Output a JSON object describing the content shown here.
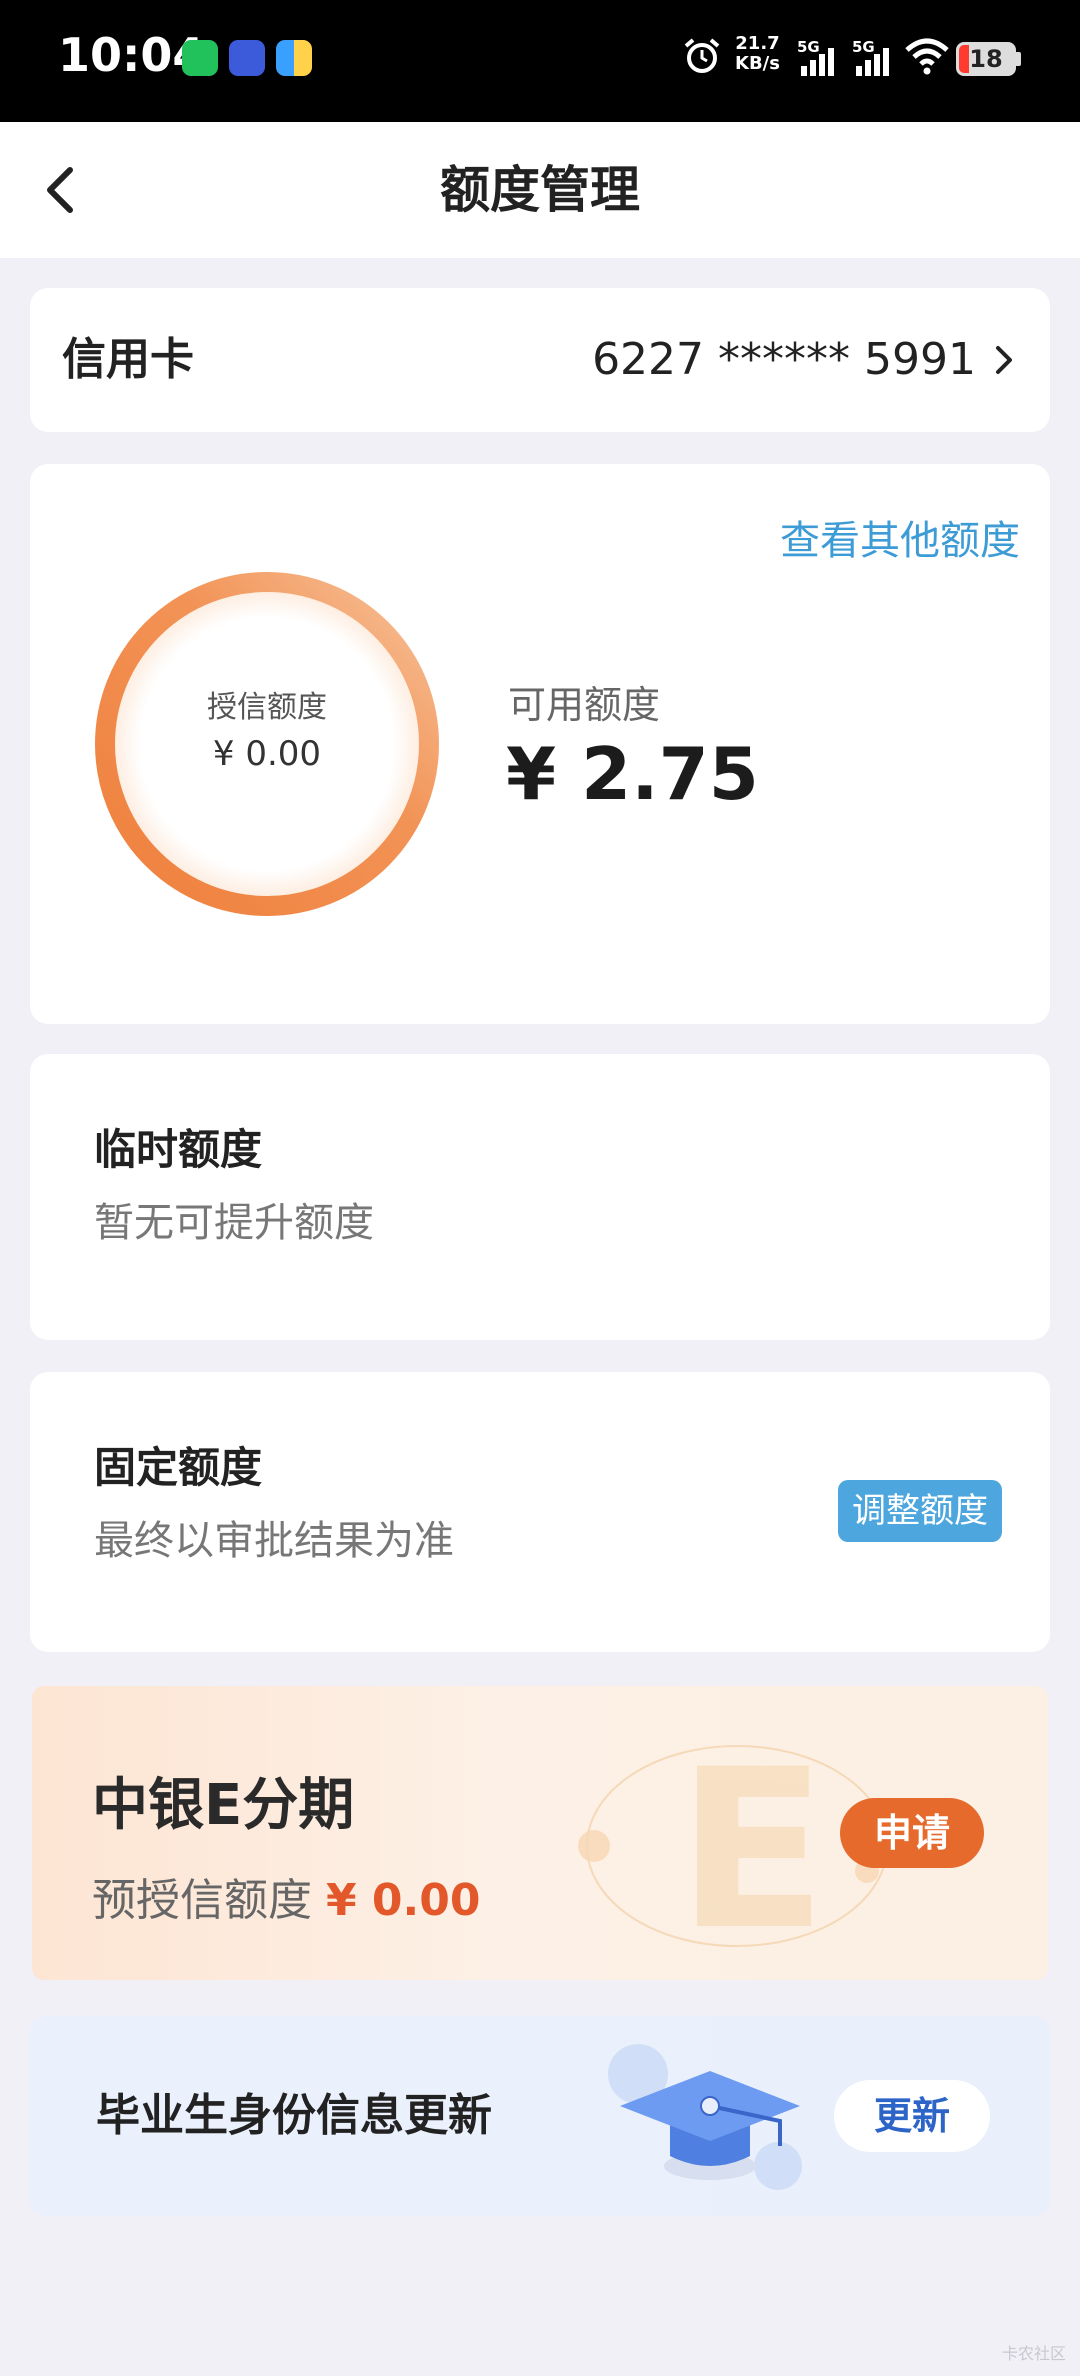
{
  "status_bar": {
    "time": "10:04",
    "net_speed_value": "21.7",
    "net_speed_unit": "KB/s",
    "signal1_label": "5G",
    "signal2_label": "5G",
    "battery": "18",
    "apps": [
      "wechat-icon",
      "vivo-icon",
      "app-icon"
    ]
  },
  "nav": {
    "title": "额度管理",
    "back_icon": "chevron-left-icon"
  },
  "card_selector": {
    "label": "信用卡",
    "number": "6227 ****** 5991"
  },
  "limit": {
    "view_other": "查看其他额度",
    "granted_label": "授信额度",
    "granted_value": "¥ 0.00",
    "available_label": "可用额度",
    "available_value": "¥ 2.75"
  },
  "temporary": {
    "title": "临时额度",
    "subtitle": "暂无可提升额度"
  },
  "fixed": {
    "title": "固定额度",
    "subtitle": "最终以审批结果为准",
    "button": "调整额度"
  },
  "e_installment": {
    "title": "中银E分期",
    "sub_label": "预授信额度",
    "amount": "¥ 0.00",
    "button": "申请"
  },
  "graduate": {
    "text": "毕业生身份信息更新",
    "button": "更新"
  },
  "colors": {
    "accent_blue": "#3d9bd6",
    "ring_orange": "#f08a47",
    "apply_orange": "#e56a2c",
    "amount_red": "#e2582b",
    "update_blue": "#2d64c8"
  },
  "watermark": "卡农社区"
}
